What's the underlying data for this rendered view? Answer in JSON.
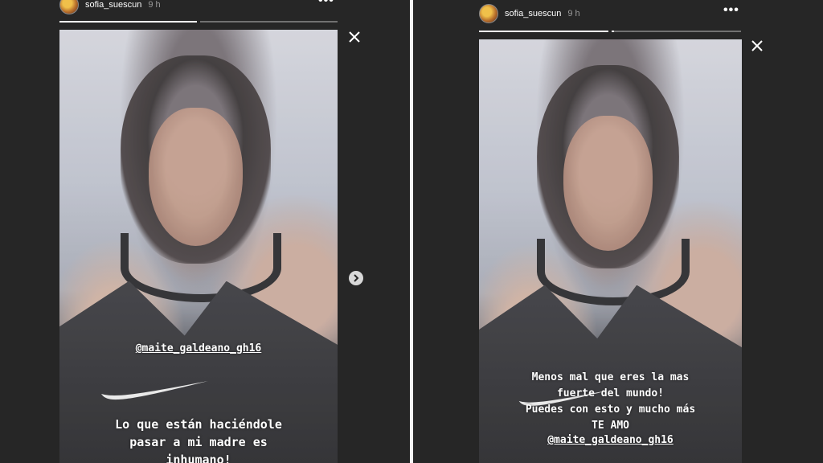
{
  "left_story": {
    "username": "sofia_suescun",
    "time": "9 h",
    "progress": [
      1.0,
      0.0
    ],
    "mention": "@maite_galdeano_gh16",
    "caption_lines": [
      "Lo que están haciéndole",
      "pasar a mi madre es",
      "inhumano!"
    ]
  },
  "right_story": {
    "username": "sofia_suescun",
    "time": "9 h",
    "progress": [
      1.0,
      0.02
    ],
    "caption_lines": [
      "Menos mal que eres la mas",
      "fuerte del mundo!",
      "Puedes con esto y mucho más",
      "TE AMO"
    ],
    "mention": "@maite_galdeano_gh16"
  },
  "icons": {
    "more": "more-options-icon",
    "close": "close-icon",
    "next": "chevron-right-icon"
  },
  "colors": {
    "background": "#262626",
    "divider": "#f4f4f4",
    "text": "#ffffff",
    "muted": "#9a9a9a"
  }
}
